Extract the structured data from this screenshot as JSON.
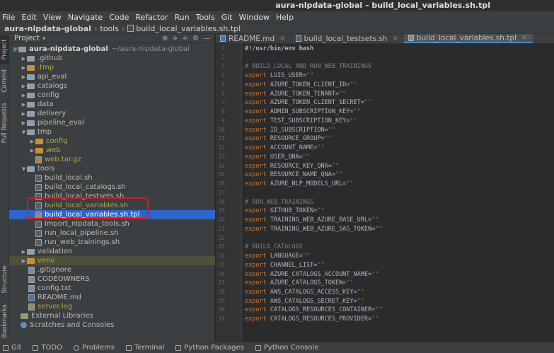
{
  "window": {
    "title": "aura-nlpdata-global – build_local_variables.sh.tpl"
  },
  "menu": [
    "File",
    "Edit",
    "View",
    "Navigate",
    "Code",
    "Refactor",
    "Run",
    "Tools",
    "Git",
    "Window",
    "Help"
  ],
  "breadcrumb": {
    "project": "aura-nlpdata-global",
    "folder": "tools",
    "file": "build_local_variables.sh.tpl"
  },
  "left_strip": [
    "Project",
    "Commit",
    "Pull Requests",
    "Structure",
    "Bookmarks"
  ],
  "project_panel": {
    "title": "Project",
    "tree": [
      {
        "label": "aura-nlpdata-global",
        "suffix": "~/aura-nlpdata-global",
        "icon": "folder-icon"
      },
      {
        "label": ".github",
        "icon": "folder-icon"
      },
      {
        "label": ".tmp",
        "icon": "folder-icon"
      },
      {
        "label": "api_eval",
        "icon": "folder-icon"
      },
      {
        "label": "catalogs",
        "icon": "folder-icon"
      },
      {
        "label": "config",
        "icon": "folder-icon"
      },
      {
        "label": "data",
        "icon": "folder-icon"
      },
      {
        "label": "delivery",
        "icon": "folder-icon"
      },
      {
        "label": "pipeline_eval",
        "icon": "folder-icon"
      },
      {
        "label": "tmp",
        "icon": "folder-icon"
      },
      {
        "label": "config",
        "icon": "folder-icon"
      },
      {
        "label": "web",
        "icon": "folder-icon"
      },
      {
        "label": "web.tar.gz",
        "icon": "archive-icon"
      },
      {
        "label": "tools",
        "icon": "folder-icon"
      },
      {
        "label": "build_local.sh",
        "icon": "shell-file-icon"
      },
      {
        "label": "build_local_catalogs.sh",
        "icon": "shell-file-icon"
      },
      {
        "label": "build_local_testsets.sh",
        "icon": "shell-file-icon"
      },
      {
        "label": "build_local_variables.sh",
        "icon": "shell-file-icon"
      },
      {
        "label": "build_local_variables.sh.tpl",
        "icon": "text-file-icon"
      },
      {
        "label": "import_nlpdata_tools.sh",
        "icon": "shell-file-icon"
      },
      {
        "label": "run_local_pipeline.sh",
        "icon": "shell-file-icon"
      },
      {
        "label": "run_web_trainings.sh",
        "icon": "shell-file-icon"
      },
      {
        "label": "validation",
        "icon": "folder-icon"
      },
      {
        "label": "venv",
        "icon": "folder-icon"
      },
      {
        "label": ".gitignore",
        "icon": "text-file-icon"
      },
      {
        "label": "CODEOWNERS",
        "icon": "text-file-icon"
      },
      {
        "label": "config.txt",
        "icon": "text-file-icon"
      },
      {
        "label": "README.md",
        "icon": "markdown-file-icon"
      },
      {
        "label": "server.log",
        "icon": "log-file-icon"
      },
      {
        "label": "External Libraries",
        "icon": "library-icon"
      },
      {
        "label": "Scratches and Consoles",
        "icon": "scratch-icon"
      }
    ]
  },
  "tabs": [
    {
      "label": "README.md",
      "active": false
    },
    {
      "label": "build_local_testsets.sh",
      "active": false
    },
    {
      "label": "build_local_variables.sh.tpl",
      "active": true
    }
  ],
  "editor": {
    "lines": [
      "#!/usr/bin/env bash",
      "",
      "# BUILD_LOCAL AND RUN_WEB_TRAININGS",
      "export LUIS_USER=\"\"",
      "export AZURE_TOKEN_CLIENT_ID=\"\"",
      "export AZURE_TOKEN_TENANT=\"\"",
      "export AZURE_TOKEN_CLIENT_SECRET=\"\"",
      "export ADMIN_SUBSCRIPTION_KEY=\"\"",
      "export TEST_SUBSCRIPTION_KEY=\"\"",
      "export ID_SUBSCRIPTION=\"\"",
      "export RESOURCE_GROUP=\"\"",
      "export ACCOUNT_NAME=\"\"",
      "export USER_QNA=\"\"",
      "export RESOURCE_KEY_QNA=\"\"",
      "export RESOURCE_NAME_QNA=\"\"",
      "export AZURE_NLP_MODELS_URL=\"\"",
      "",
      "# RUN_WEB_TRAININGS",
      "export GITHUB_TOKEN=\"\"",
      "export TRAINING_WEB_AZURE_BASE_URL=\"\"",
      "export TRAINING_WEB_AZURE_SAS_TOKEN=\"\"",
      "",
      "# BUILD_CATALOGS",
      "export LANGUAGE=\"\"",
      "export CHANNEL_LIST=\"\"",
      "export AZURE_CATALOGS_ACCOUNT_NAME=\"\"",
      "export AZURE_CATALOGS_TOKEN=\"\"",
      "export AWS_CATALOGS_ACCESS_KEY=\"\"",
      "export AWS_CATALOGS_SECRET_KEY=\"\"",
      "export CATALOGS_RESOURCES_CONTAINER=\"\"",
      "export CATALOGS_RESOURCES_PROVIDER=\"\""
    ]
  },
  "status_bar": [
    "Git",
    "TODO",
    "Problems",
    "Terminal",
    "Python Packages",
    "Python Console"
  ]
}
